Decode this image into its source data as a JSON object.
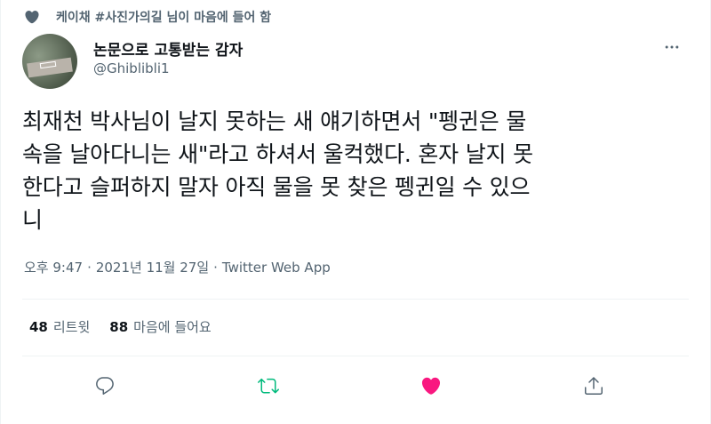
{
  "social_context": {
    "icon": "heart-icon",
    "text": "케이채 #사진가의길 님이 마음에 들어 함"
  },
  "author": {
    "display_name": "논문으로 고통받는 감자",
    "handle": "@Ghiblibli1",
    "avatar_icon": "avatar"
  },
  "tweet": {
    "text": "최재천 박사님이 날지 못하는 새 얘기하면서 \"펭귄은 물\n속을 날아다니는 새\"라고 하셔서 울컥했다. 혼자 날지 못\n한다고 슬퍼하지 말자 아직 물을 못 찾은 펭귄일 수 있으\n니"
  },
  "meta": {
    "time": "오후 9:47",
    "separator": "·",
    "date": "2021년 11월 27일",
    "source": "Twitter Web App"
  },
  "stats": {
    "retweets_count": "48",
    "retweets_label": "리트윗",
    "likes_count": "88",
    "likes_label": "마음에 들어요"
  },
  "actions": {
    "reply_icon": "reply-icon",
    "retweet_icon": "retweet-icon",
    "like_icon": "like-icon",
    "share_icon": "share-icon"
  },
  "colors": {
    "secondary_text": "#536471",
    "retweet_green": "#00ba7c",
    "like_pink": "#f91880",
    "primary_text": "#0f1419"
  }
}
